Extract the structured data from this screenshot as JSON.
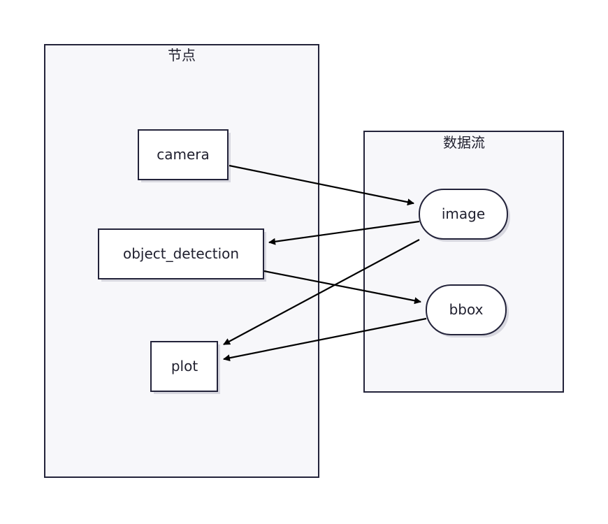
{
  "clusters": {
    "nodes": {
      "label": "节点"
    },
    "dataflow": {
      "label": "数据流"
    }
  },
  "nodes": {
    "camera": "camera",
    "object_detection": "object_detection",
    "plot": "plot",
    "image": "image",
    "bbox": "bbox"
  },
  "edges": [
    {
      "from": "camera",
      "to": "image"
    },
    {
      "from": "image",
      "to": "object_detection"
    },
    {
      "from": "image",
      "to": "plot"
    },
    {
      "from": "object_detection",
      "to": "bbox"
    },
    {
      "from": "bbox",
      "to": "plot"
    }
  ]
}
